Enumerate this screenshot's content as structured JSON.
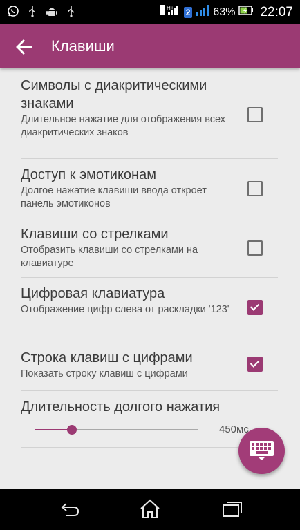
{
  "status_bar": {
    "battery_percent": "63%",
    "time": "22:07",
    "sim_badge": "2",
    "network_label": "H+",
    "notification_icons": [
      "whatsapp-icon",
      "usb-icon",
      "android-debug-icon",
      "usb-icon"
    ]
  },
  "app_bar": {
    "title": "Клавиши",
    "back_icon": "arrow-left-icon"
  },
  "preferences": [
    {
      "title": "Символы с диакритическими знаками",
      "summary": "Длительное нажатие для отображения всех диакритических знаков",
      "checked": false
    },
    {
      "title": "Доступ к эмотиконам",
      "summary": "Долгое нажатие клавиши ввода откроет панель эмотиконов",
      "checked": false
    },
    {
      "title": "Клавиши со стрелками",
      "summary": "Отобразить клавиши со стрелками на клавиатуре",
      "checked": false
    },
    {
      "title": "Цифровая клавиатура",
      "summary": "Отображение цифр слева от раскладки '123'",
      "checked": true
    },
    {
      "title": "Строка клавиш с цифрами",
      "summary": "Показать строку клавиш с цифрами",
      "checked": true
    }
  ],
  "long_press": {
    "title": "Длительность долгого нажатия",
    "value_label": "450мс",
    "fraction": 0.23
  },
  "fab": {
    "icon": "keyboard-icon"
  },
  "nav_bar": {
    "icons": [
      "back-icon",
      "home-icon",
      "recents-icon"
    ]
  },
  "colors": {
    "accent": "#9b3a73",
    "background": "#ececec"
  }
}
